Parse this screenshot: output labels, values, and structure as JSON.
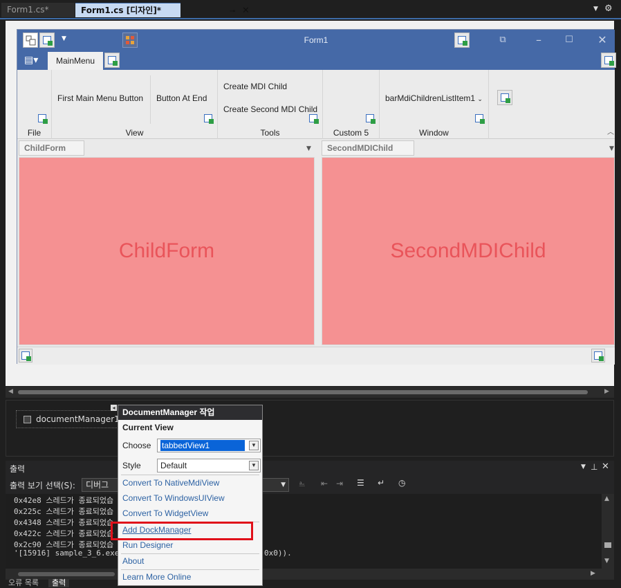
{
  "doc_tabs": [
    {
      "label": "Form1.cs*"
    },
    {
      "label": "Form1.cs [디자인]*"
    }
  ],
  "pin_glyph": "⊸",
  "close_glyph": "✕",
  "form": {
    "title": "Form1",
    "main_tab": "MainMenu"
  },
  "ribbon": {
    "groups": [
      {
        "label": "File"
      },
      {
        "label": "View",
        "buttons": [
          "First Main Menu Button",
          "Button At End"
        ]
      },
      {
        "label": "Tools",
        "buttons": [
          "Create MDI Child",
          "Create Second MDI Child"
        ]
      },
      {
        "label": "Custom 5"
      },
      {
        "label": "Window",
        "buttons": [
          "barMdiChildrenListItem1"
        ]
      }
    ]
  },
  "mdi": {
    "panels": [
      {
        "tab": "ChildForm",
        "body": "ChildForm"
      },
      {
        "tab": "SecondMDIChild",
        "body": "SecondMDIChild"
      }
    ]
  },
  "tray": {
    "component": "documentManager1"
  },
  "output": {
    "title": "출력",
    "source_label": "출력 보기 선택(S):",
    "source_value": "디버그",
    "lines": [
      "0x42e8 스레드가 종료되었습",
      "0x225c 스레드가 종료되었습",
      "0x4348 스레드가 종료되었습",
      "0x422c 스레드가 종료되었습",
      "0x2c90 스레드가 종료되었습",
      "'[15916] sample_3_6.exe'"
    ],
    "line_tail": "0x0)).",
    "bottom_tabs": [
      "오류 목록",
      "출력"
    ]
  },
  "popup": {
    "header": "DocumentManager 작업",
    "section": "Current View",
    "choose_label": "Choose",
    "choose_value": "tabbedView1",
    "style_label": "Style",
    "style_value": "Default",
    "links": [
      "Convert To NativeMdiView",
      "Convert To WindowsUIView",
      "Convert To WidgetView",
      "Add DockManager",
      "Run Designer",
      "About",
      "Learn More Online"
    ]
  },
  "colors": {
    "accent": "#4569a7",
    "panel_bg": "#f59192",
    "panel_text": "#e9545a",
    "highlight": "#e0101a"
  }
}
